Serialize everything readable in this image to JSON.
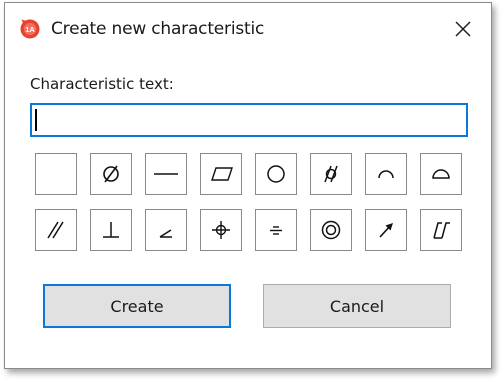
{
  "window": {
    "title": "Create new characteristic",
    "app_icon": "app-logo-icon",
    "close_icon": "close-icon"
  },
  "form": {
    "label": "Characteristic text:",
    "input_value": ""
  },
  "symbols": {
    "row1": [
      {
        "name": "blank-symbol-button",
        "icon": "blank"
      },
      {
        "name": "diameter-symbol-button",
        "icon": "diameter-icon"
      },
      {
        "name": "straightness-symbol-button",
        "icon": "straightness-icon"
      },
      {
        "name": "flatness-symbol-button",
        "icon": "flatness-icon"
      },
      {
        "name": "circularity-symbol-button",
        "icon": "circularity-icon"
      },
      {
        "name": "cylindricity-symbol-button",
        "icon": "cylindricity-icon"
      },
      {
        "name": "profile-of-line-symbol-button",
        "icon": "profile-of-line-icon"
      },
      {
        "name": "profile-of-surface-symbol-button",
        "icon": "profile-of-surface-icon"
      }
    ],
    "row2": [
      {
        "name": "parallelism-symbol-button",
        "icon": "parallelism-icon"
      },
      {
        "name": "perpendicularity-symbol-button",
        "icon": "perpendicularity-icon"
      },
      {
        "name": "angularity-symbol-button",
        "icon": "angularity-icon"
      },
      {
        "name": "position-symbol-button",
        "icon": "position-icon"
      },
      {
        "name": "symmetry-symbol-button",
        "icon": "symmetry-icon"
      },
      {
        "name": "concentricity-symbol-button",
        "icon": "concentricity-icon"
      },
      {
        "name": "circular-runout-symbol-button",
        "icon": "circular-runout-icon"
      },
      {
        "name": "total-runout-symbol-button",
        "icon": "total-runout-icon"
      }
    ]
  },
  "buttons": {
    "create": "Create",
    "cancel": "Cancel"
  },
  "colors": {
    "accent": "#0a78d7",
    "icon_red": "#e8412c"
  }
}
